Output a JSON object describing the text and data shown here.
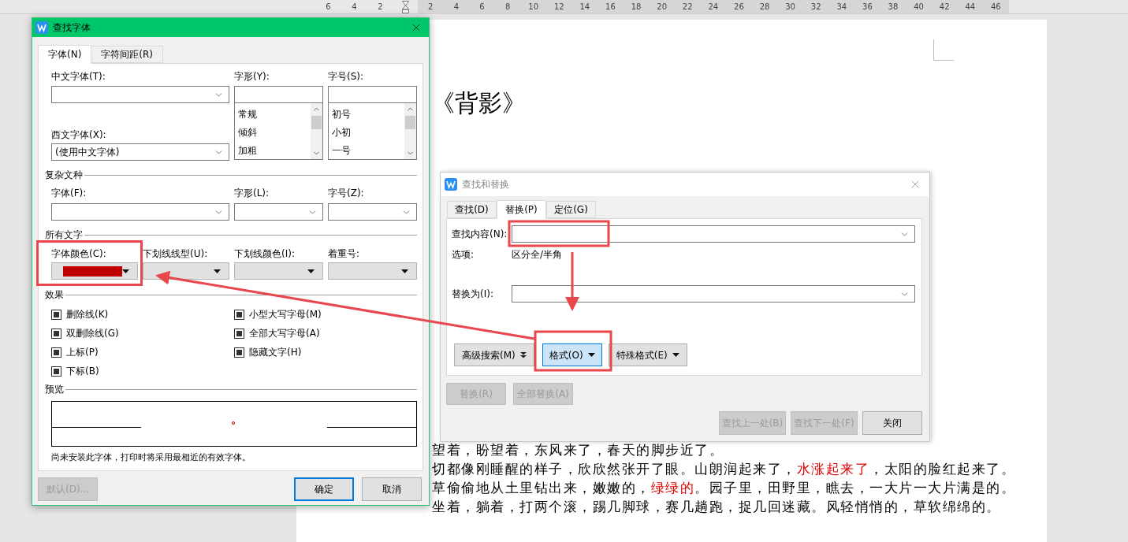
{
  "ruler": {
    "left_labels": [
      "6",
      "4",
      "2"
    ],
    "right_labels": [
      "2",
      "4",
      "6",
      "8",
      "10",
      "12",
      "14",
      "16",
      "18",
      "20",
      "22",
      "24",
      "26",
      "28",
      "30",
      "32",
      "34",
      "36",
      "38",
      "40",
      "42",
      "44",
      "46"
    ]
  },
  "document": {
    "title": "《背影》",
    "lines": [
      {
        "segments": [
          {
            "text": "望着，盼望着，东风来了，春天的脚步近了。",
            "emphasis": false
          }
        ]
      },
      {
        "segments": [
          {
            "text": "切都像刚睡醒的样子，欣欣然张开了眼。山朗润起来了，",
            "emphasis": false
          },
          {
            "text": "水涨起来了",
            "emphasis": true
          },
          {
            "text": "，太阳的脸红起来了。",
            "emphasis": false
          }
        ]
      },
      {
        "segments": [
          {
            "text": "草偷偷地从土里钻出来，嫩嫩的，",
            "emphasis": false
          },
          {
            "text": "绿绿的",
            "emphasis": true
          },
          {
            "text": "。园子里，田野里，瞧去，一大片一大片满是的。",
            "emphasis": false
          }
        ]
      },
      {
        "segments": [
          {
            "text": "坐着，躺着，打两个滚，踢几脚球，赛几趟跑，捉几回迷藏。风轻悄悄的，草软绵绵的。",
            "emphasis": false
          }
        ]
      }
    ]
  },
  "font_dialog": {
    "title": "查找字体",
    "active": true,
    "tabs": [
      {
        "label": "字体(N)",
        "selected": true
      },
      {
        "label": "字符间距(R)",
        "selected": false
      }
    ],
    "chinese_font": {
      "label": "中文字体(T):"
    },
    "western_font": {
      "label": "西文字体(X):",
      "value": "(使用中文字体)"
    },
    "style": {
      "label": "字形(Y):",
      "options": [
        "常规",
        "倾斜",
        "加粗"
      ]
    },
    "size": {
      "label": "字号(S):",
      "options": [
        "初号",
        "小初",
        "一号"
      ]
    },
    "complex": {
      "heading": "复杂文种",
      "fields": [
        {
          "label": "字体(F):"
        },
        {
          "label": "字形(L):"
        },
        {
          "label": "字号(Z):"
        }
      ]
    },
    "all_text": {
      "heading": "所有文字",
      "fields": [
        {
          "label": "字体颜色(C):",
          "color": "#c00000"
        },
        {
          "label": "下划线线型(U):"
        },
        {
          "label": "下划线颜色(I):"
        },
        {
          "label": "着重号:"
        }
      ]
    },
    "effects": {
      "heading": "效果",
      "options": [
        {
          "label": "删除线(K)",
          "indeterminate": true
        },
        {
          "label": "双删除线(G)",
          "indeterminate": true
        },
        {
          "label": "上标(P)",
          "indeterminate": true
        },
        {
          "label": "下标(B)",
          "indeterminate": true
        },
        {
          "label": "小型大写字母(M)",
          "indeterminate": true
        },
        {
          "label": "全部大写字母(A)",
          "indeterminate": true
        },
        {
          "label": "隐藏文字(H)",
          "indeterminate": true
        }
      ]
    },
    "preview": {
      "heading": "预览"
    },
    "note": "尚未安装此字体，打印时将采用最相近的有效字体。",
    "buttons": [
      {
        "label": "默认(D)...",
        "disabled": true,
        "default": false
      },
      {
        "label": "确定",
        "disabled": false,
        "default": true
      },
      {
        "label": "取消",
        "disabled": false,
        "default": false
      }
    ]
  },
  "replace_dialog": {
    "title": "查找和替换",
    "active": false,
    "tabs": [
      {
        "label": "查找(D)",
        "selected": false
      },
      {
        "label": "替换(P)",
        "selected": true
      },
      {
        "label": "定位(G)",
        "selected": false
      }
    ],
    "find": {
      "label": "查找内容(N):"
    },
    "options": {
      "label": "选项:",
      "value": "区分全/半角"
    },
    "replace": {
      "label": "替换为(I):"
    },
    "tool_buttons": [
      {
        "label": "高级搜索(M)",
        "kind": "expand",
        "highlighted": false
      },
      {
        "label": "格式(O)",
        "kind": "menu",
        "highlighted": true
      },
      {
        "label": "特殊格式(E)",
        "kind": "menu",
        "highlighted": false
      }
    ],
    "action_buttons": [
      {
        "label": "替换(R)",
        "disabled": true
      },
      {
        "label": "全部替换(A)",
        "disabled": true
      }
    ],
    "nav_buttons": [
      {
        "label": "查找上一处(B)",
        "disabled": true
      },
      {
        "label": "查找下一处(F)",
        "disabled": true
      },
      {
        "label": "关闭",
        "disabled": false
      }
    ]
  }
}
